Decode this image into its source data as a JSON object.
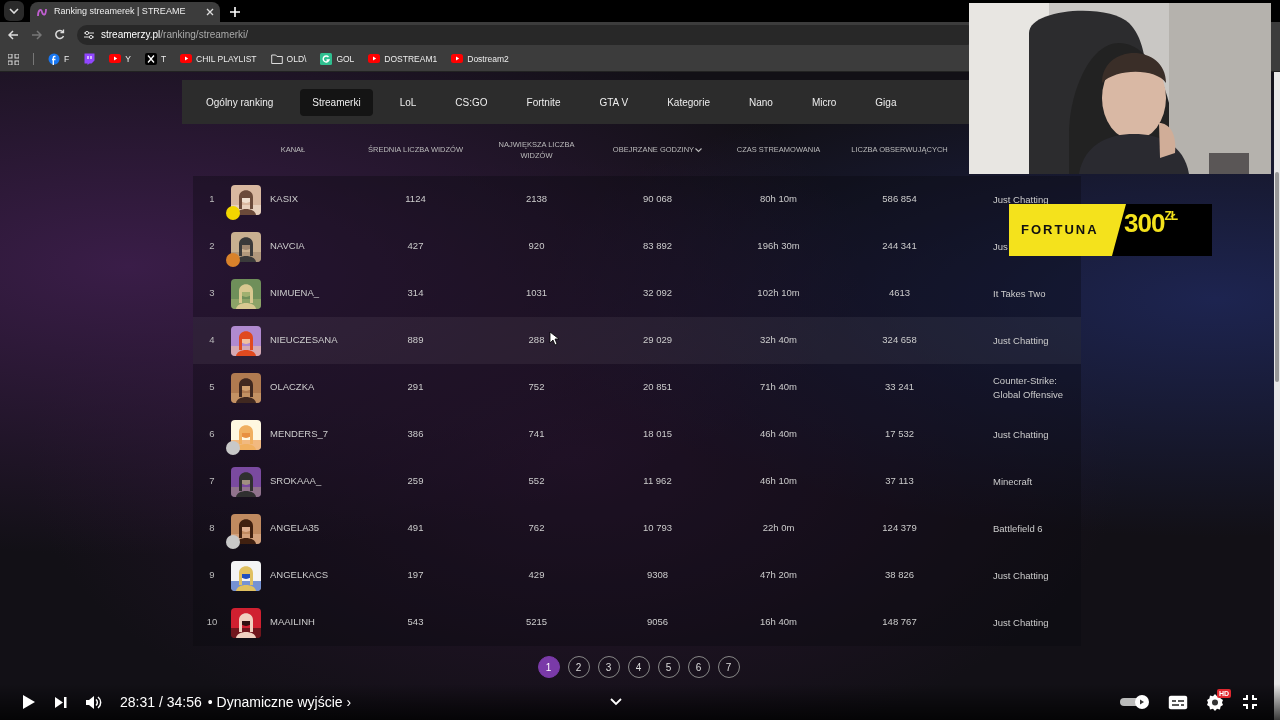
{
  "browser": {
    "tab_title": "Ranking streamerek | STREAME",
    "address_host": "streamerzy.pl",
    "address_path": "/ranking/streamerki/",
    "bookmarks": [
      {
        "label": "F"
      },
      {
        "label": "Y"
      },
      {
        "label": "T"
      },
      {
        "label": "CHIL PLAYLIST"
      },
      {
        "label": "OLD\\"
      },
      {
        "label": "GOL"
      },
      {
        "label": "DOSTREAM1"
      },
      {
        "label": "Dostream2"
      }
    ]
  },
  "nav": [
    {
      "label": "Ogólny ranking",
      "selected": false
    },
    {
      "label": "Streamerki",
      "selected": true
    },
    {
      "label": "LoL",
      "selected": false
    },
    {
      "label": "CS:GO",
      "selected": false
    },
    {
      "label": "Fortnite",
      "selected": false
    },
    {
      "label": "GTA V",
      "selected": false
    },
    {
      "label": "Kategorie",
      "selected": false
    },
    {
      "label": "Nano",
      "selected": false
    },
    {
      "label": "Micro",
      "selected": false
    },
    {
      "label": "Giga",
      "selected": false
    }
  ],
  "table": {
    "columns": [
      {
        "label": "KANAŁ",
        "sorted": false
      },
      {
        "label": "ŚREDNIA LICZBA WIDZÓW",
        "sorted": false
      },
      {
        "label": "NAJWIĘKSZA LICZBA WIDZÓW",
        "sorted": false
      },
      {
        "label": "OBEJRZANE GODZINY",
        "sorted": true
      },
      {
        "label": "CZAS STREAMOWANIA",
        "sorted": false
      },
      {
        "label": "LICZBA OBSERWUJĄCYCH",
        "sorted": false
      }
    ],
    "rows": [
      {
        "rank": "1",
        "channel": "KASIX",
        "avg": "1124",
        "max": "2138",
        "hours": "90 068",
        "time": "80h 10m",
        "followers": "586 854",
        "game": "Just Chatting",
        "highlighted": false,
        "color": "#f2d600"
      },
      {
        "rank": "2",
        "channel": "NAVCIA",
        "avg": "427",
        "max": "920",
        "hours": "83 892",
        "time": "196h 30m",
        "followers": "244 341",
        "game": "Jus",
        "highlighted": false,
        "color": "#d9822b"
      },
      {
        "rank": "3",
        "channel": "NIMUENA_",
        "avg": "314",
        "max": "1031",
        "hours": "32 092",
        "time": "102h 10m",
        "followers": "4613",
        "game": "It Takes Two",
        "highlighted": false
      },
      {
        "rank": "4",
        "channel": "NIEUCZESANA",
        "avg": "889",
        "max": "288",
        "hours": "29 029",
        "time": "32h 40m",
        "followers": "324 658",
        "game": "Just Chatting",
        "highlighted": true
      },
      {
        "rank": "5",
        "channel": "OLACZKA",
        "avg": "291",
        "max": "752",
        "hours": "20 851",
        "time": "71h 40m",
        "followers": "33 241",
        "game": "Counter-Strike: Global Offensive",
        "highlighted": false
      },
      {
        "rank": "6",
        "channel": "MENDERS_7",
        "avg": "386",
        "max": "741",
        "hours": "18 015",
        "time": "46h 40m",
        "followers": "17 532",
        "game": "Just Chatting",
        "highlighted": false,
        "color": "#c8c8c8"
      },
      {
        "rank": "7",
        "channel": "SROKAAA_",
        "avg": "259",
        "max": "552",
        "hours": "11 962",
        "time": "46h 10m",
        "followers": "37 113",
        "game": "Minecraft",
        "highlighted": false
      },
      {
        "rank": "8",
        "channel": "ANGELA35",
        "avg": "491",
        "max": "762",
        "hours": "10 793",
        "time": "22h 0m",
        "followers": "124 379",
        "game": "Battlefield 6",
        "highlighted": false,
        "color": "#c8c8c8"
      },
      {
        "rank": "9",
        "channel": "ANGELKACS",
        "avg": "197",
        "max": "429",
        "hours": "9308",
        "time": "47h 20m",
        "followers": "38 826",
        "game": "Just Chatting",
        "highlighted": false
      },
      {
        "rank": "10",
        "channel": "MAAILINH",
        "avg": "543",
        "max": "5215",
        "hours": "9056",
        "time": "16h 40m",
        "followers": "148 767",
        "game": "Just Chatting",
        "highlighted": false
      }
    ]
  },
  "pages": [
    {
      "label": "1",
      "selected": true
    },
    {
      "label": "2",
      "selected": false
    },
    {
      "label": "3",
      "selected": false
    },
    {
      "label": "4",
      "selected": false
    },
    {
      "label": "5",
      "selected": false
    },
    {
      "label": "6",
      "selected": false
    },
    {
      "label": "7",
      "selected": false
    }
  ],
  "ad": {
    "brand": "FORTUNA",
    "amount": "300$^{ZŁ}$"
  },
  "player": {
    "time": "28:31 / 34:56",
    "chapter": "• Dynamiczne wyjście ›",
    "autoplay": true,
    "quality_badge": "HD"
  }
}
